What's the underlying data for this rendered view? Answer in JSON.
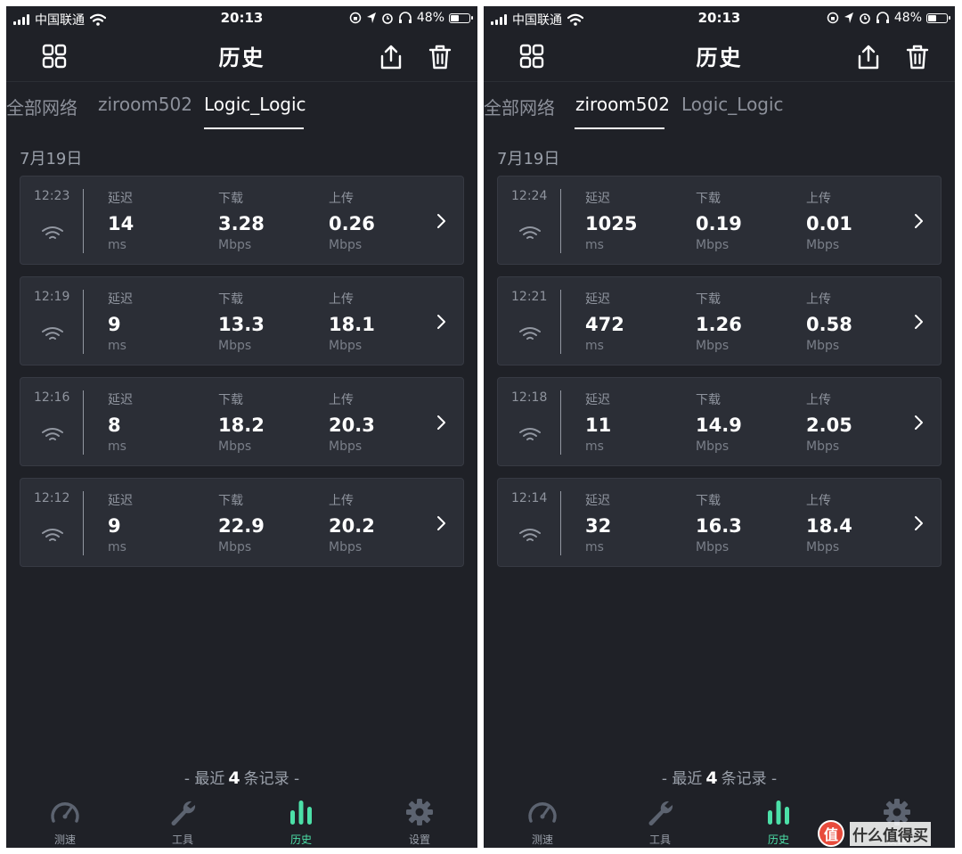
{
  "screens": [
    {
      "status": {
        "carrier": "中国联通",
        "time": "20:13",
        "battery": "48%",
        "battery_level": 0.48
      },
      "title": "历史",
      "tabs": [
        {
          "label": "全部网络",
          "active": false
        },
        {
          "label": "ziroom502",
          "active": false
        },
        {
          "label": "Logic_Logic",
          "active": true
        }
      ],
      "date": "7月19日",
      "column_labels": {
        "latency": "延迟",
        "download": "下载",
        "upload": "上传"
      },
      "units": {
        "latency": "ms",
        "speed": "Mbps"
      },
      "records": [
        {
          "time": "12:23",
          "latency": "14",
          "download": "3.28",
          "upload": "0.26"
        },
        {
          "time": "12:19",
          "latency": "9",
          "download": "13.3",
          "upload": "18.1"
        },
        {
          "time": "12:16",
          "latency": "8",
          "download": "18.2",
          "upload": "20.3"
        },
        {
          "time": "12:12",
          "latency": "9",
          "download": "22.9",
          "upload": "20.2"
        }
      ],
      "footer": {
        "prefix": "-  最近",
        "count": "4",
        "suffix": "条记录  -"
      },
      "tabbar": [
        "测速",
        "工具",
        "历史",
        "设置"
      ],
      "tabbar_active": "历史"
    },
    {
      "status": {
        "carrier": "中国联通",
        "time": "20:13",
        "battery": "48%",
        "battery_level": 0.48
      },
      "title": "历史",
      "tabs": [
        {
          "label": "全部网络",
          "active": false
        },
        {
          "label": "ziroom502",
          "active": true
        },
        {
          "label": "Logic_Logic",
          "active": false
        }
      ],
      "date": "7月19日",
      "column_labels": {
        "latency": "延迟",
        "download": "下载",
        "upload": "上传"
      },
      "units": {
        "latency": "ms",
        "speed": "Mbps"
      },
      "records": [
        {
          "time": "12:24",
          "latency": "1025",
          "download": "0.19",
          "upload": "0.01"
        },
        {
          "time": "12:21",
          "latency": "472",
          "download": "1.26",
          "upload": "0.58"
        },
        {
          "time": "12:18",
          "latency": "11",
          "download": "14.9",
          "upload": "2.05"
        },
        {
          "time": "12:14",
          "latency": "32",
          "download": "16.3",
          "upload": "18.4"
        }
      ],
      "footer": {
        "prefix": "-  最近",
        "count": "4",
        "suffix": "条记录  -"
      },
      "tabbar": [
        "测速",
        "工具",
        "历史",
        "设置"
      ],
      "tabbar_active": "历史"
    }
  ],
  "watermark": {
    "badge": "值",
    "text": "什么值得买"
  },
  "colors": {
    "background": "#1f2127",
    "card": "#2b2e36",
    "accent": "#4ce0a8",
    "muted": "#8f949e"
  }
}
